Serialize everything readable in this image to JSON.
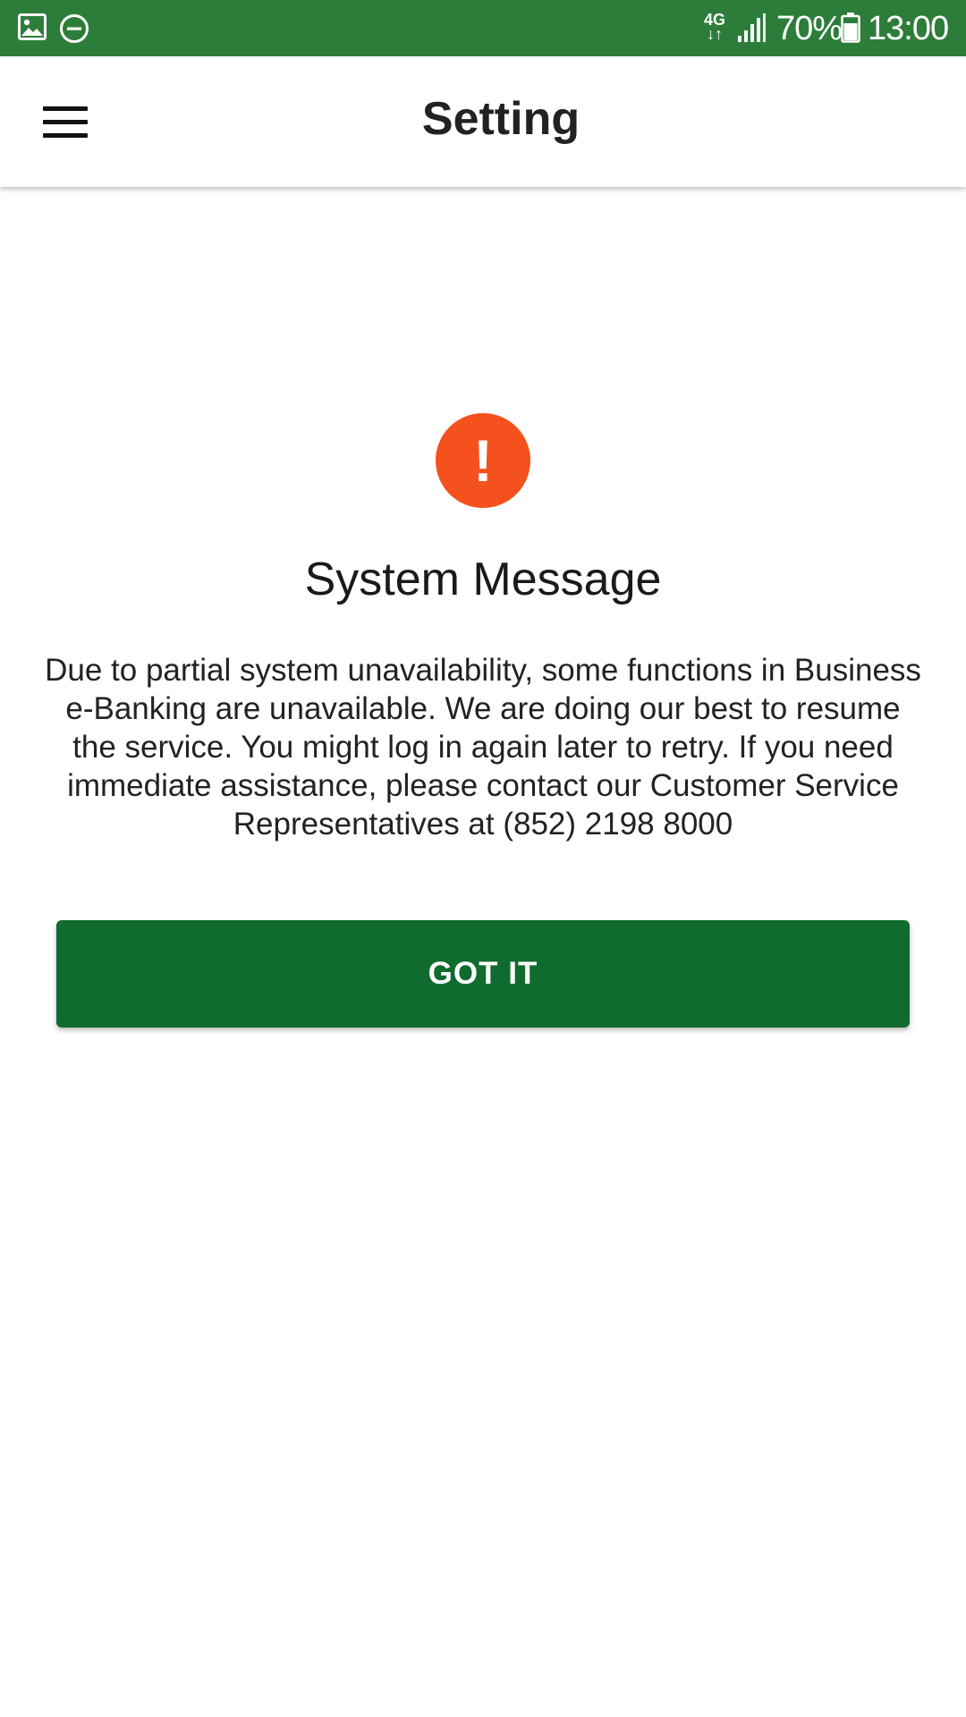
{
  "status_bar": {
    "network_type": "4G",
    "battery_level": "70%",
    "time": "13:00",
    "icons": [
      "image-icon",
      "do-not-disturb-icon",
      "network-4g-icon",
      "signal-icon",
      "battery-icon"
    ],
    "background_color": "#2d7d3a"
  },
  "app_bar": {
    "title": "Setting",
    "menu_icon": "hamburger-menu-icon"
  },
  "system_message": {
    "icon": "alert-icon",
    "icon_symbol": "!",
    "icon_color": "#f4511e",
    "title": "System Message",
    "body": "Due to partial system unavailability, some functions in Business e-Banking are unavailable. We are doing our best to resume the service. You might log in again later to retry. If you need immediate assistance, please contact our Customer Service Representatives at (852) 2198 8000",
    "button_label": "GOT IT",
    "button_color": "#0f6b2e"
  }
}
